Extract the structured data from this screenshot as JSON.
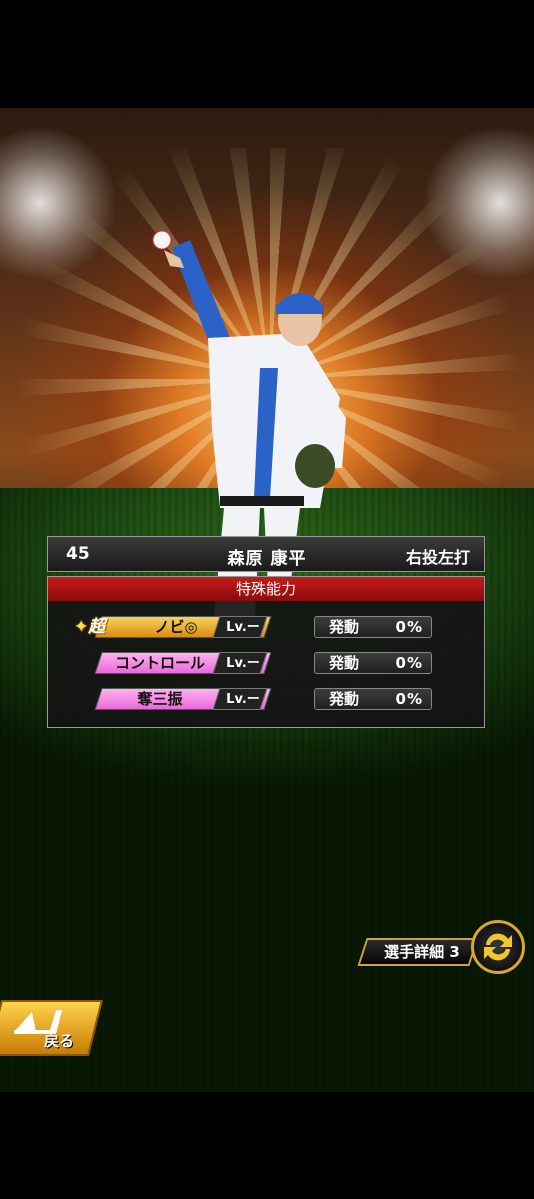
{
  "player": {
    "number": "45",
    "name": "森原 康平",
    "handedness": "右投左打"
  },
  "abilities": {
    "header": "特殊能力",
    "super_mark": "超",
    "items": [
      {
        "name": "ノビ◎",
        "level": "Lv.ー",
        "tier": "gold",
        "effect_label": "発動",
        "effect_value": "0%"
      },
      {
        "name": "コントロール",
        "level": "Lv.ー",
        "tier": "pink",
        "effect_label": "発動",
        "effect_value": "0%"
      },
      {
        "name": "奪三振",
        "level": "Lv.ー",
        "tier": "pink",
        "effect_label": "発動",
        "effect_value": "0%"
      }
    ]
  },
  "buttons": {
    "detail": "選手詳細 3",
    "back": "戻る"
  },
  "colors": {
    "header_red": "#c81a1a",
    "gold_tag": "#f0b628",
    "pink_tag": "#f58ae4",
    "accent_gold": "#d7a82a"
  }
}
